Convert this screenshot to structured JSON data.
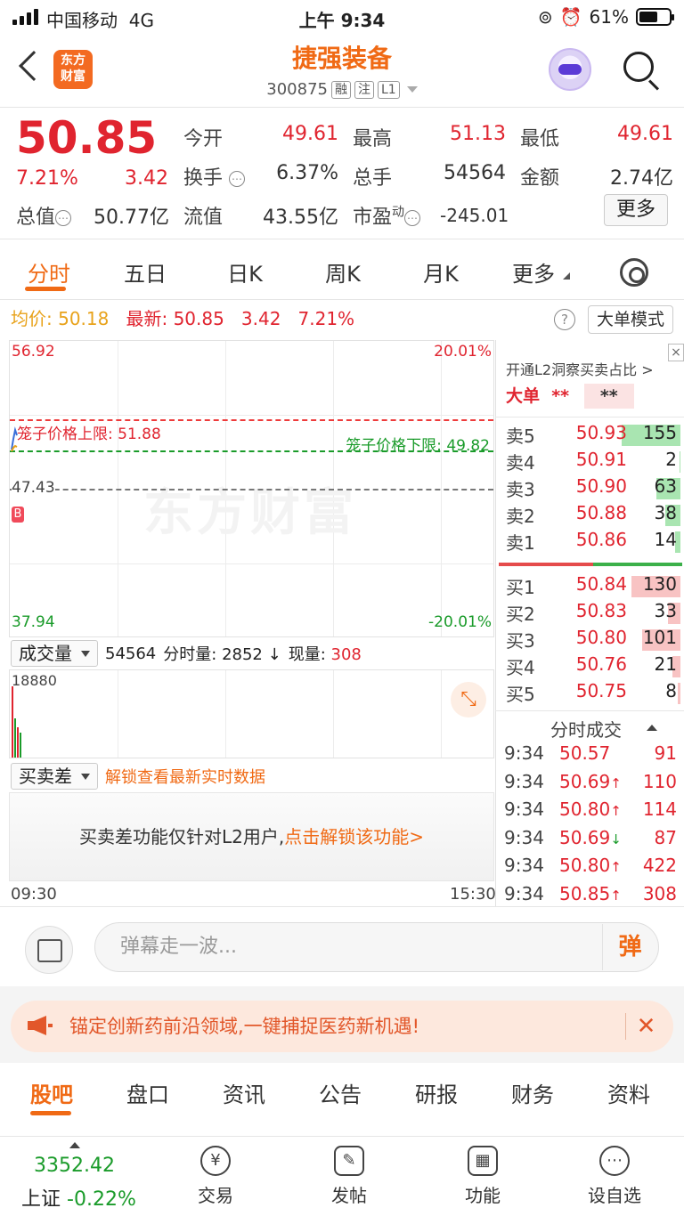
{
  "status": {
    "carrier": "中国移动",
    "network": "4G",
    "time": "上午 9:34",
    "battery": "61%",
    "battery_level": 0.61
  },
  "header": {
    "logo_line1": "东方",
    "logo_line2": "财富",
    "stock_name": "捷强装备",
    "stock_code": "300875",
    "tags": [
      "融",
      "注",
      "L1"
    ]
  },
  "quote": {
    "price": "50.85",
    "change_pct": "7.21%",
    "change": "3.42",
    "open_label": "今开",
    "open": "49.61",
    "high_label": "最高",
    "high": "51.13",
    "low_label": "最低",
    "low": "49.61",
    "turnover_label": "换手",
    "turnover": "6.37%",
    "volume_label": "总手",
    "volume": "54564",
    "amount_label": "金额",
    "amount": "2.74亿",
    "mktcap_label": "总值",
    "mktcap": "50.77亿",
    "float_label": "流值",
    "float_cap": "43.55亿",
    "pe_label": "市盈",
    "pe_sup": "动",
    "pe": "-245.01",
    "more": "更多"
  },
  "tabs": [
    "分时",
    "五日",
    "日K",
    "周K",
    "月K",
    "更多"
  ],
  "avg_line": {
    "avg_label": "均价:",
    "avg": "50.18",
    "latest_label": "最新:",
    "latest": "50.85",
    "chg": "3.42",
    "pct": "7.21%"
  },
  "big_order_btn": "大单模式",
  "chart": {
    "top_price": "56.92",
    "top_pct": "20.01%",
    "bottom_price": "37.94",
    "bottom_pct": "-20.01%",
    "prev_close": "47.43",
    "cage_upper_label": "笼子价格上限:",
    "cage_upper": "51.88",
    "cage_lower_label": "笼子价格下限:",
    "cage_lower": "49.82",
    "b_marker": "B",
    "watermark": "东方财富",
    "time_start": "09:30",
    "time_end": "15:30"
  },
  "volume": {
    "select": "成交量",
    "total": "54564",
    "minute_label": "分时量:",
    "minute": "2852",
    "arrow": "↓",
    "current_label": "现量:",
    "current": "308",
    "max": "18880"
  },
  "spread": {
    "select": "买卖差",
    "unlock_link": "解锁查看最新实时数据",
    "msg_prefix": "买卖差功能仅针对L2用户,",
    "msg_link": "点击解锁该功能"
  },
  "orderbook": {
    "promo": "开通L2洞察买卖占比",
    "big_label": "大单",
    "big_val1": "**",
    "big_val2": "**",
    "asks": [
      {
        "label": "卖5",
        "price": "50.93",
        "qty": "155",
        "fill": 1.0
      },
      {
        "label": "卖4",
        "price": "50.91",
        "qty": "2",
        "fill": 0.02
      },
      {
        "label": "卖3",
        "price": "50.90",
        "qty": "63",
        "fill": 0.41
      },
      {
        "label": "卖2",
        "price": "50.88",
        "qty": "38",
        "fill": 0.25
      },
      {
        "label": "卖1",
        "price": "50.86",
        "qty": "14",
        "fill": 0.09
      }
    ],
    "bids": [
      {
        "label": "买1",
        "price": "50.84",
        "qty": "130",
        "fill": 0.84
      },
      {
        "label": "买2",
        "price": "50.83",
        "qty": "33",
        "fill": 0.21
      },
      {
        "label": "买3",
        "price": "50.80",
        "qty": "101",
        "fill": 0.65
      },
      {
        "label": "买4",
        "price": "50.76",
        "qty": "21",
        "fill": 0.14
      },
      {
        "label": "买5",
        "price": "50.75",
        "qty": "8",
        "fill": 0.05
      }
    ],
    "ticks_title": "分时成交",
    "ticks": [
      {
        "time": "9:34",
        "price": "50.57",
        "dir": "",
        "vol": "91"
      },
      {
        "time": "9:34",
        "price": "50.69",
        "dir": "↑",
        "vol": "110"
      },
      {
        "time": "9:34",
        "price": "50.80",
        "dir": "↑",
        "vol": "114"
      },
      {
        "time": "9:34",
        "price": "50.69",
        "dir": "↓",
        "vol": "87"
      },
      {
        "time": "9:34",
        "price": "50.80",
        "dir": "↑",
        "vol": "422"
      },
      {
        "time": "9:34",
        "price": "50.85",
        "dir": "↑",
        "vol": "308"
      }
    ]
  },
  "comment": {
    "placeholder": "弹幕走一波...",
    "danmu": "弹"
  },
  "promo_banner": "锚定创新药前沿领域,一键捕捉医药新机遇!",
  "bottom_tabs": [
    "股吧",
    "盘口",
    "资讯",
    "公告",
    "研报",
    "财务",
    "资料"
  ],
  "tabbar": {
    "index_value": "3352.42",
    "index_name": "上证",
    "index_change": "-0.22%",
    "items": [
      {
        "label": "交易",
        "glyph": "¥"
      },
      {
        "label": "发帖",
        "glyph": "✎"
      },
      {
        "label": "功能",
        "glyph": "▦"
      },
      {
        "label": "设自选",
        "glyph": "⋯"
      }
    ]
  },
  "colors": {
    "up": "#e0242f",
    "down": "#1a9b2a",
    "accent": "#f06a15"
  }
}
